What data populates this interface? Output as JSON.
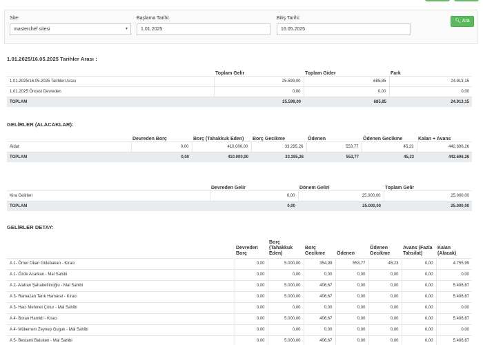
{
  "filter": {
    "site_label": "Site:",
    "site_value": "masterchef sitesi",
    "start_label": "Başlama Tarihi:",
    "start_value": "1.01.2025",
    "end_label": "Bitiş Tarihi:",
    "end_value": "16.05.2025",
    "search_label": "Ara"
  },
  "summary": {
    "title": "1.01.2025/16.05.2025 Tarihler Arası :",
    "headers": [
      "Toplam Gelir",
      "Toplam Gider",
      "Fark"
    ],
    "rows": [
      {
        "label": "1.01.2025/16.05.2025 Tarihleri Arası",
        "values": [
          "25.599,00",
          "685,85",
          "24.913,15"
        ]
      },
      {
        "label": "1.01.2025 Öncesi Devreden",
        "values": [
          "0,00",
          "0,00",
          "0,00"
        ]
      }
    ],
    "total": {
      "label": "TOPLAM",
      "values": [
        "25.599,00",
        "685,85",
        "24.913,15"
      ]
    }
  },
  "receivables": {
    "title": "GELİRLER (ALACAKLAR):",
    "headers": [
      "Devreden Borç",
      "Borç (Tahakkuk Eden)",
      "Borç Gecikme",
      "Ödenen",
      "Ödenen Gecikme",
      "Kalan + Avans"
    ],
    "rows": [
      {
        "label": "Aidat",
        "values": [
          "0,00",
          "410.000,00",
          "33.295,26",
          "553,77",
          "45,23",
          "442.696,26"
        ]
      }
    ],
    "total": {
      "label": "TOPLAM",
      "values": [
        "0,00",
        "410.000,00",
        "33.295,26",
        "553,77",
        "45,23",
        "442.696,26"
      ]
    }
  },
  "other_income": {
    "headers": [
      "Devreden Gelir",
      "Dönem Geliri",
      "Toplam Gelir"
    ],
    "rows": [
      {
        "label": "Kira Gelirleri",
        "values": [
          "0,00",
          "25.000,00",
          "25.000,00"
        ]
      }
    ],
    "total": {
      "label": "TOPLAM",
      "values": [
        "0,00",
        "25.000,00",
        "25.000,00"
      ]
    }
  },
  "detail": {
    "title": "GELİRLER DETAY:",
    "headers": [
      "Devreden\nBorç",
      "Borç\n(Tahakkuk\nEden)",
      "Borç\nGecikme",
      "Ödenen",
      "Ödenen\nGecikme",
      "Avans (Fazla\nTahsilat)",
      "Kalan\n(Alacak)"
    ],
    "rows": [
      {
        "label": "A 1- Ömer Okan Gülebakan - Kiracı",
        "values": [
          "0,00",
          "5.000,00",
          "354,99",
          "553,77",
          "45,23",
          "0,00",
          "4.755,99"
        ]
      },
      {
        "label": "A 1- Özde Acarkan - Mal Sahibi",
        "values": [
          "0,00",
          "0,00",
          "0,00",
          "0,00",
          "0,00",
          "0,00",
          "0,00"
        ]
      },
      {
        "label": "A 2- Atahan Şahabettinoğlu - Mal Sahibi",
        "values": [
          "0,00",
          "5.000,00",
          "406,67",
          "0,00",
          "0,00",
          "0,00",
          "5.406,67"
        ]
      },
      {
        "label": "A 3- Ramazan Tarık Hamarat - Kiracı",
        "values": [
          "0,00",
          "5.000,00",
          "406,67",
          "0,00",
          "0,00",
          "0,00",
          "5.406,67"
        ]
      },
      {
        "label": "A 3- Hacı Mehmet Çotur - Mal Sahibi",
        "values": [
          "0,00",
          "0,00",
          "0,00",
          "0,00",
          "0,00",
          "0,00",
          "0,00"
        ]
      },
      {
        "label": "A 4- Boran Hamidi - Kiracı",
        "values": [
          "0,00",
          "5.000,00",
          "406,67",
          "0,00",
          "0,00",
          "0,00",
          "5.406,67"
        ]
      },
      {
        "label": "A 4- Mükerrem Zeynep Guguk - Mal Sahibi",
        "values": [
          "0,00",
          "0,00",
          "0,00",
          "0,00",
          "0,00",
          "0,00",
          "0,00"
        ]
      },
      {
        "label": "A 5- Bestami Baluken - Mal Sahibi",
        "values": [
          "0,00",
          "5.000,00",
          "406,67",
          "0,00",
          "0,00",
          "0,00",
          "5.406,67"
        ]
      }
    ]
  }
}
